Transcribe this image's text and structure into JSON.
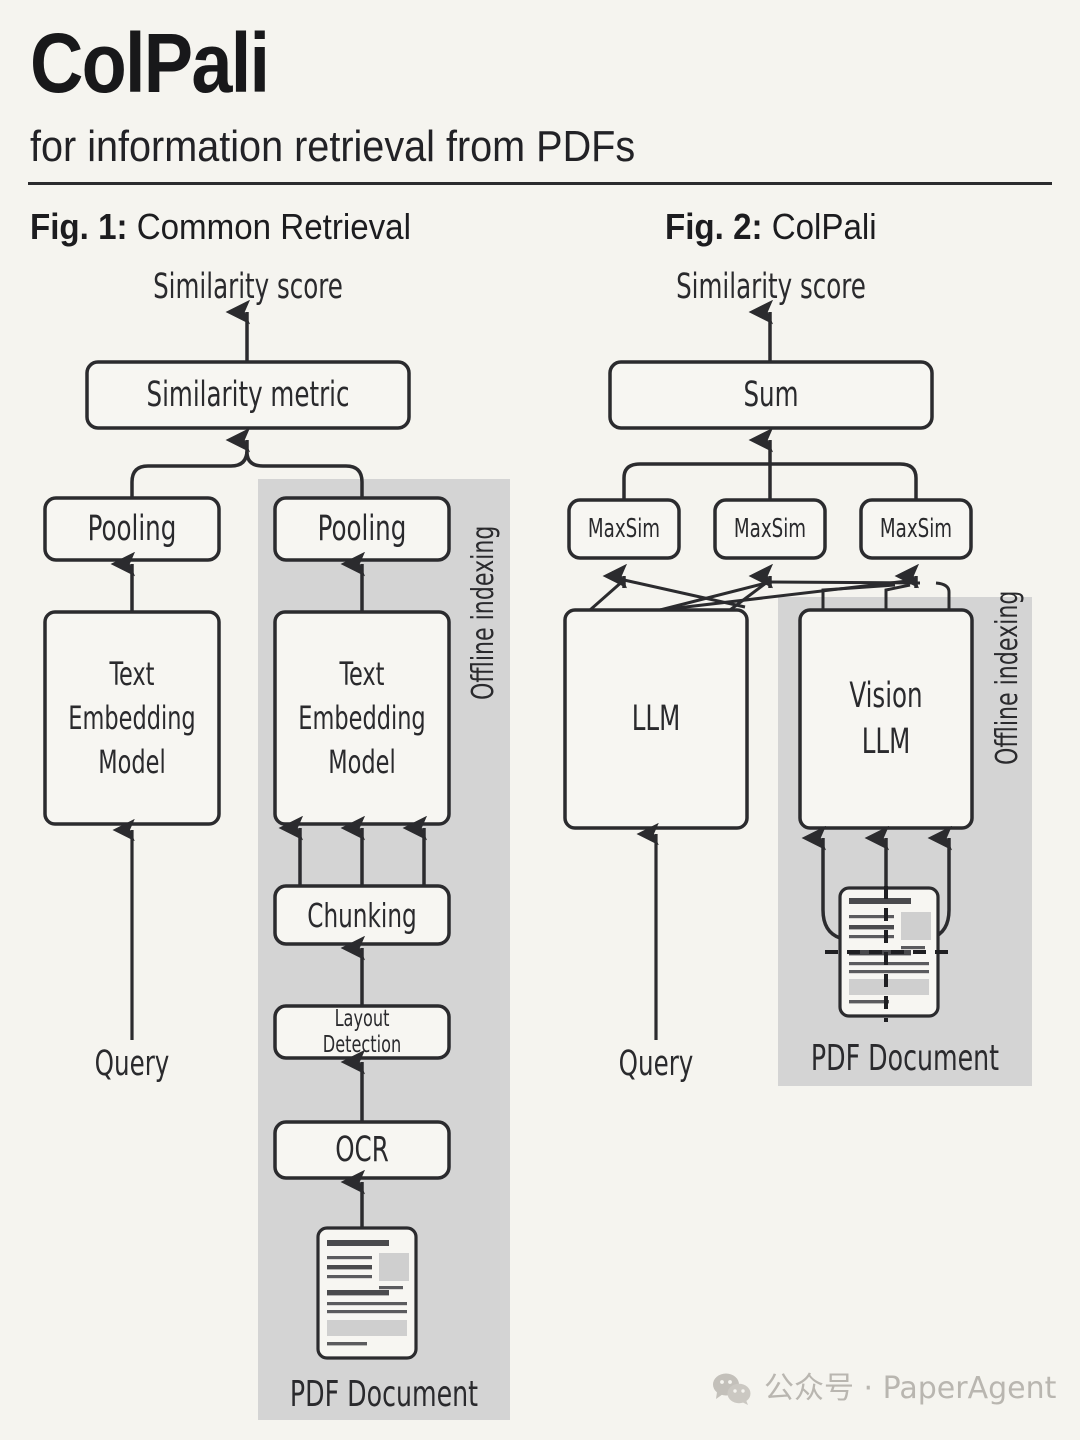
{
  "header": {
    "title": "ColPali",
    "subtitle": "for information retrieval from PDFs"
  },
  "figures": [
    {
      "id": "fig1",
      "label_bold": "Fig. 1:",
      "label_rest": " Common Retrieval",
      "top_label": "Similarity score",
      "shaded_region_label": "Offline indexing",
      "nodes": [
        {
          "name": "similarity-metric",
          "label": "Similarity metric"
        },
        {
          "name": "pooling-query",
          "label": "Pooling"
        },
        {
          "name": "pooling-doc",
          "label": "Pooling"
        },
        {
          "name": "text-embedding-model-query",
          "label": "Text\nEmbedding\nModel"
        },
        {
          "name": "text-embedding-model-doc",
          "label": "Text\nEmbedding\nModel"
        },
        {
          "name": "chunking",
          "label": "Chunking"
        },
        {
          "name": "layout-detection",
          "label": "Layout Detection"
        },
        {
          "name": "ocr",
          "label": "OCR"
        }
      ],
      "input_query_label": "Query",
      "input_document_label": "PDF Document"
    },
    {
      "id": "fig2",
      "label_bold": "Fig. 2:",
      "label_rest": " ColPali",
      "top_label": "Similarity score",
      "shaded_region_label": "Offline indexing",
      "nodes": [
        {
          "name": "sum",
          "label": "Sum"
        },
        {
          "name": "maxsim-1",
          "label": "MaxSim"
        },
        {
          "name": "maxsim-2",
          "label": "MaxSim"
        },
        {
          "name": "maxsim-3",
          "label": "MaxSim"
        },
        {
          "name": "llm",
          "label": "LLM"
        },
        {
          "name": "vision-llm",
          "label": "Vision\nLLM"
        }
      ],
      "input_query_label": "Query",
      "input_document_label": "PDF Document"
    }
  ],
  "watermark": {
    "icon": "wechat-icon",
    "text": "公众号 · PaperAgent"
  },
  "colors": {
    "background": "#f5f4ef",
    "stroke": "#2b2b2e",
    "box_fill": "#f7f6f2",
    "shaded_panel": "#d4d4d4",
    "doc_accent": "#4a4a4d",
    "doc_block": "#cfcfcf",
    "watermark": "#b9b6b0"
  }
}
